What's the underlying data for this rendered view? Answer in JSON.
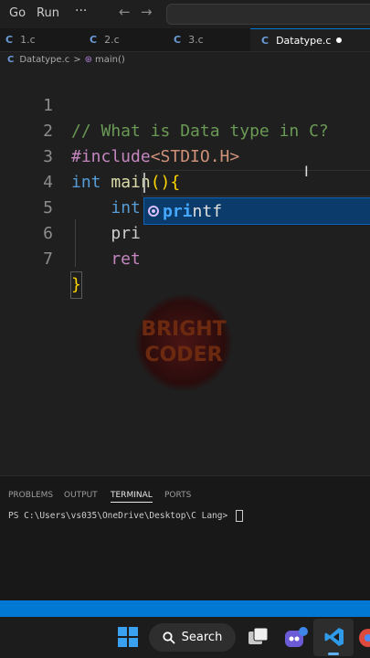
{
  "menubar": {
    "items": [
      "Go",
      "Run"
    ],
    "more": "···"
  },
  "tabs": [
    {
      "label": "1.c",
      "icon": "C",
      "active": false
    },
    {
      "label": "2.c",
      "icon": "C",
      "active": false
    },
    {
      "label": "3.c",
      "icon": "C",
      "active": false
    },
    {
      "label": "Datatype.c",
      "icon": "C",
      "active": true,
      "modified": true
    }
  ],
  "breadcrumb": {
    "file": "Datatype.c",
    "separator": ">",
    "symbol": "main()"
  },
  "editor": {
    "lines": [
      {
        "n": "1",
        "code": "// What is Data type in C?"
      },
      {
        "n": "2",
        "code": "#include<STDIO.H>"
      },
      {
        "n": "3",
        "code": "int main(){"
      },
      {
        "n": "4",
        "code": "    int a = 4;"
      },
      {
        "n": "5",
        "code": "    pri"
      },
      {
        "n": "6",
        "code": "    ret"
      },
      {
        "n": "7",
        "code": "}"
      }
    ],
    "suggestion": {
      "match": "pri",
      "rest": "ntf"
    }
  },
  "watermark": {
    "line1": "BRIGHT",
    "line2": "CODER"
  },
  "panel": {
    "tabs": [
      "PROBLEMS",
      "OUTPUT",
      "TERMINAL",
      "PORTS"
    ],
    "active_tab": "TERMINAL",
    "prompt": "PS C:\\Users\\vs035\\OneDrive\\Desktop\\C Lang> "
  },
  "taskbar": {
    "search_label": "Search"
  },
  "colors": {
    "comment": "#6a9955",
    "preprocessor": "#c586c0",
    "include": "#ce9178",
    "keyword": "#569cd6",
    "function": "#dcdcaa",
    "bracket": "#ffd700",
    "number": "#b5cea8",
    "accent": "#0078d4"
  }
}
